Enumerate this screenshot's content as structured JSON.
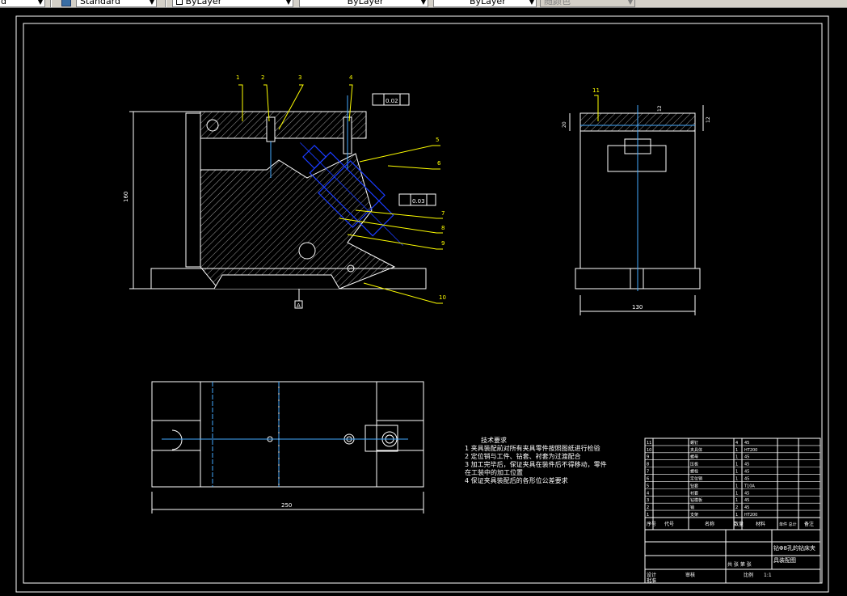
{
  "toolbar": {
    "style_combo_left": "d",
    "text_style": "Standard",
    "layer_color": "ByLayer",
    "linetype": "ByLayer",
    "lineweight": "ByLayer",
    "plot_style": "随颜色"
  },
  "drawing": {
    "front_view": {
      "balloons": [
        "1",
        "2",
        "3",
        "4",
        "5",
        "6",
        "7",
        "8",
        "9",
        "10"
      ],
      "tolerance_top": "0.02",
      "tolerance_mid": "0.03",
      "datum": "A",
      "dim_height": "160"
    },
    "side_view": {
      "balloon": "11",
      "dim_left": "20",
      "dim_right": "12",
      "dim_center": "12",
      "dim_width": "130"
    },
    "top_view": {
      "dim_length": "250"
    },
    "notes": {
      "title": "技术要求",
      "items": [
        "1  夹具装配前对所有夹具零件按照图纸进行检验",
        "2  定位销与工件、钻套、衬套为过渡配合",
        "3  加工完毕后，保证夹具在装件后不得移动，零件",
        "   在工装中的加工位置",
        "4  保证夹具装配后的各形位公差要求"
      ]
    },
    "title_block": {
      "parts": [
        {
          "no": "11",
          "name": "螺钉",
          "qty": "4",
          "mat": "45"
        },
        {
          "no": "10",
          "name": "夹具体",
          "qty": "1",
          "mat": "HT200"
        },
        {
          "no": "9",
          "name": "螺母",
          "qty": "1",
          "mat": "45"
        },
        {
          "no": "8",
          "name": "压板",
          "qty": "1",
          "mat": "45"
        },
        {
          "no": "7",
          "name": "螺栓",
          "qty": "1",
          "mat": "45"
        },
        {
          "no": "6",
          "name": "定位销",
          "qty": "1",
          "mat": "45"
        },
        {
          "no": "5",
          "name": "钻套",
          "qty": "1",
          "mat": "T10A"
        },
        {
          "no": "4",
          "name": "衬套",
          "qty": "1",
          "mat": "45"
        },
        {
          "no": "3",
          "name": "钻模板",
          "qty": "1",
          "mat": "45"
        },
        {
          "no": "2",
          "name": "销",
          "qty": "2",
          "mat": "45"
        },
        {
          "no": "1",
          "name": "支架",
          "qty": "1",
          "mat": "HT200"
        }
      ],
      "header": {
        "seq": "序号",
        "code": "代号",
        "name": "名称",
        "qty": "数量",
        "material": "材料",
        "weight": "单件 总计",
        "note": "备注"
      },
      "title_line1": "钻Φ8孔的钻床夹",
      "title_line2": "具装配图",
      "scale_label": "比例",
      "scale_value": "1:1",
      "sheet": "共 张 第 张",
      "designer": "设计",
      "checker": "审核",
      "approve": "批准"
    }
  }
}
